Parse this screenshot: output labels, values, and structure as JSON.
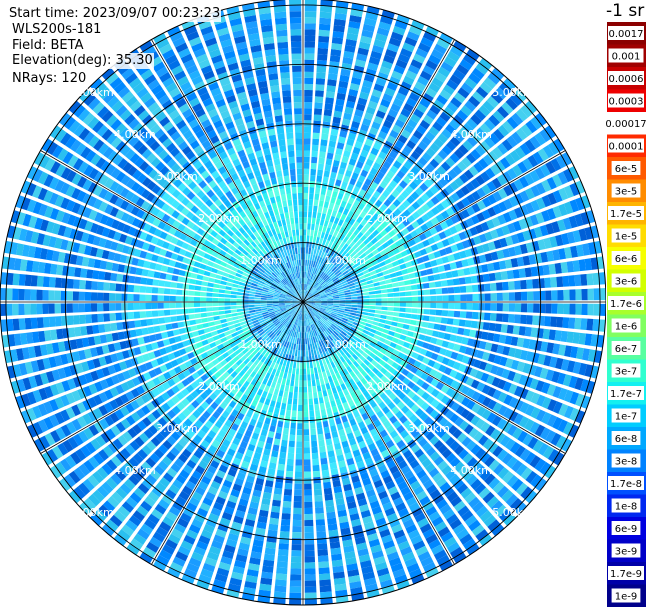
{
  "header": {
    "start_time": "Start time: 2023/09/07 00:23:23",
    "instrument": "WLS200s-181",
    "field": "Field: BETA",
    "elevation": "Elevation(deg): 35.30",
    "nrays": "NRays: 120"
  },
  "colorbar": {
    "unit_fragment": "-1 sr",
    "labels": [
      "0.0017",
      "0.001",
      "0.0006",
      "0.0003",
      "0.00017",
      "0.0001",
      "6e-5",
      "3e-5",
      "1.7e-5",
      "1e-5",
      "6e-6",
      "3e-6",
      "1.7e-6",
      "1e-6",
      "6e-7",
      "3e-7",
      "1.7e-7",
      "1e-7",
      "6e-8",
      "3e-8",
      "1.7e-8",
      "1e-8",
      "6e-9",
      "3e-9",
      "1.7e-9",
      "1e-9"
    ],
    "colors": [
      "#8b0000",
      "#a00000",
      "#c80000",
      "#ee0000",
      "#ffffff",
      "#ff2a00",
      "#ff5a00",
      "#ff8c00",
      "#ffb400",
      "#ffdc00",
      "#f6ff00",
      "#d2ff00",
      "#a8ff2c",
      "#80ff60",
      "#58ffa0",
      "#30ffd0",
      "#14f0f0",
      "#00cdff",
      "#00a8ff",
      "#0082ff",
      "#0050ff",
      "#0028f0",
      "#0000e0",
      "#0000c8",
      "#0000a8",
      "#00008b"
    ]
  },
  "chart_data": {
    "type": "heatmap",
    "projection": "polar PPI scan",
    "field": "BETA",
    "elevation_deg": 35.3,
    "n_rays": 120,
    "range_unit": "km",
    "range_max_km": 5.1,
    "range_rings_km": [
      1,
      2,
      3,
      4,
      5
    ],
    "ring_labels": [
      "1.00km",
      "2.00km",
      "3.00km",
      "4.00km",
      "5.00km"
    ],
    "radial_spokes_deg": [
      0,
      30,
      60,
      90,
      120,
      150,
      180,
      210,
      240,
      270,
      300,
      330
    ],
    "value_bands": [
      {
        "range_km": [
          0,
          1.0
        ],
        "dominant_beta": "1.7e-7"
      },
      {
        "range_km": [
          1.0,
          2.0
        ],
        "dominant_beta": "3e-7"
      },
      {
        "range_km": [
          2.0,
          3.0
        ],
        "dominant_beta": "1e-7"
      },
      {
        "range_km": [
          3.0,
          5.1
        ],
        "dominant_beta": "6e-8"
      }
    ],
    "colorbar_range": [
      "1e-9",
      "0.0017"
    ],
    "colorbar_scale": "log",
    "grid": true
  }
}
